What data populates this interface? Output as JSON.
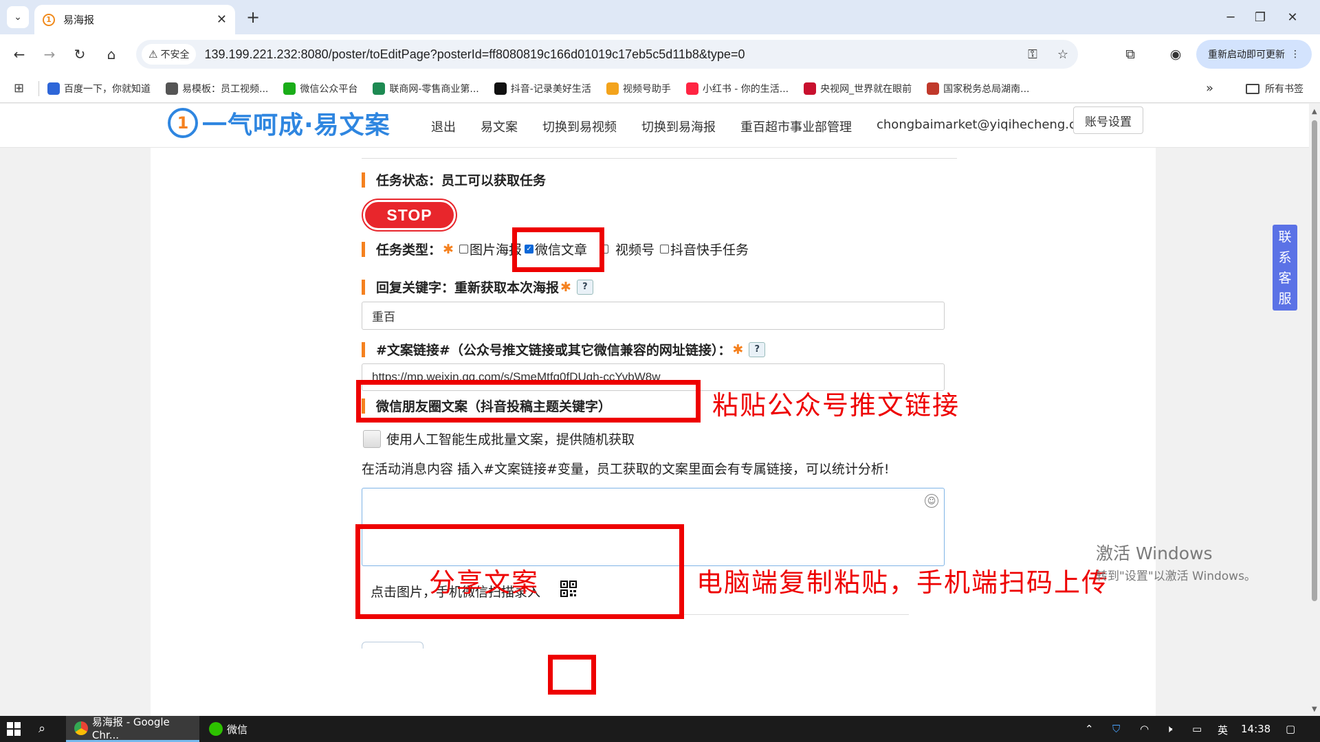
{
  "browser": {
    "tab_title": "易海报",
    "url": "139.199.221.232:8080/poster/toEditPage?posterId=ff8080819c166d01019c17eb5c5d11b8&type=0",
    "security_label": "不安全",
    "update_button": "重新启动即可更新",
    "bookmarks": [
      {
        "label": "百度一下，你就知道",
        "icon": "baidu-icon",
        "color": "#2e66d8"
      },
      {
        "label": "易模板：员工视频...",
        "icon": "globe-icon",
        "color": "#555555"
      },
      {
        "label": "微信公众平台",
        "icon": "wechat-icon",
        "color": "#1aad19"
      },
      {
        "label": "联商网-零售商业第...",
        "icon": "lianshang-icon",
        "color": "#1d8a52"
      },
      {
        "label": "抖音-记录美好生活",
        "icon": "douyin-icon",
        "color": "#111111"
      },
      {
        "label": "视频号助手",
        "icon": "channels-icon",
        "color": "#f3a31c"
      },
      {
        "label": "小红书 - 你的生活...",
        "icon": "xiaohongshu-icon",
        "color": "#ff2442"
      },
      {
        "label": "央视网_世界就在眼前",
        "icon": "cctv-icon",
        "color": "#c8102e"
      },
      {
        "label": "国家税务总局湖南...",
        "icon": "tax-icon",
        "color": "#c0392b"
      }
    ],
    "all_bookmarks": "所有书签"
  },
  "site": {
    "logo_text": "一气呵成·易文案",
    "nav": [
      "退出",
      "易文案",
      "切换到易视频",
      "切换到易海报",
      "重百超市事业部管理",
      "chongbaimarket@yiqihecheng.cc"
    ],
    "account_button": "账号设置"
  },
  "form": {
    "task_status_label": "任务状态：员工可以获取任务",
    "stop_button": "STOP",
    "task_type_label": "任务类型：",
    "task_types": [
      {
        "label": "图片海报",
        "checked": false
      },
      {
        "label": "微信文章",
        "checked": true
      },
      {
        "label": "视频号",
        "checked": false
      },
      {
        "label": "抖音快手任务",
        "checked": false
      }
    ],
    "reply_keyword_label": "回复关键字：重新获取本次海报",
    "reply_keyword_value": "重百",
    "link_label": "#文案链接#（公众号推文链接或其它微信兼容的网址链接）：",
    "link_value": "https://mp.weixin.qq.com/s/SmeMtfq0fDUgh-ccYvbW8w",
    "moments_label": "微信朋友圈文案（抖音投稿主题关键字）",
    "ai_option": "使用人工智能生成批量文案，提供随机获取",
    "hint": "在活动消息内容 插入#文案链接#变量，员工获取的文案里面会有专属链接，可以统计分析!",
    "scan_hint": "点击图片，手机微信扫描录入"
  },
  "annotations": {
    "paste_link": "粘贴公众号推文链接",
    "share_copy": "分享文案",
    "pc_mobile": "电脑端复制粘贴，手机端扫码上传"
  },
  "contact_service": [
    "联",
    "系",
    "客",
    "服"
  ],
  "watermark": {
    "line1": "激活 Windows",
    "line2": "转到\"设置\"以激活 Windows。"
  },
  "taskbar": {
    "apps": [
      {
        "label": "易海报 - Google Chr...",
        "active": true
      },
      {
        "label": "微信",
        "active": false
      }
    ],
    "ime": "英",
    "time": "14:38"
  }
}
